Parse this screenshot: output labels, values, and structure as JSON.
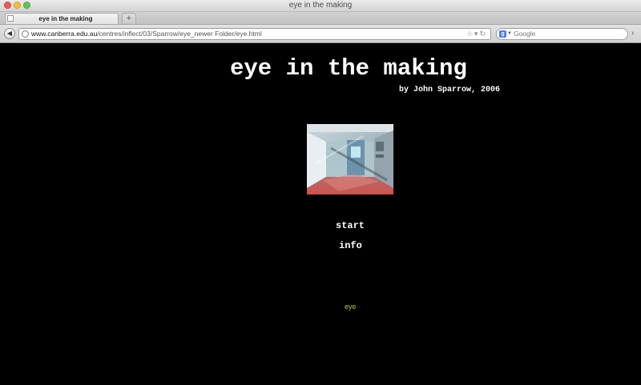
{
  "window": {
    "title": "eye in the making"
  },
  "tabs": [
    {
      "label": "eye in the making"
    }
  ],
  "toolbar": {
    "url_host": "www.canberra.edu.au",
    "url_path": "/centres/inflect/03/Sparrow/eye_newer Folder/eye.html",
    "search_placeholder": "Google"
  },
  "page": {
    "title": "eye in the making",
    "byline": "by John Sparrow, 2006",
    "links": {
      "start": "start",
      "info": "info",
      "eye": "eye"
    }
  },
  "colors": {
    "background": "#000000",
    "text": "#ffffff",
    "eye_link": "#c7c13a"
  },
  "icons": {
    "back": "back-arrow-icon",
    "star": "star-icon",
    "reload": "reload-icon",
    "search_engine": "google-icon",
    "extension": "chevron-right-icon"
  }
}
